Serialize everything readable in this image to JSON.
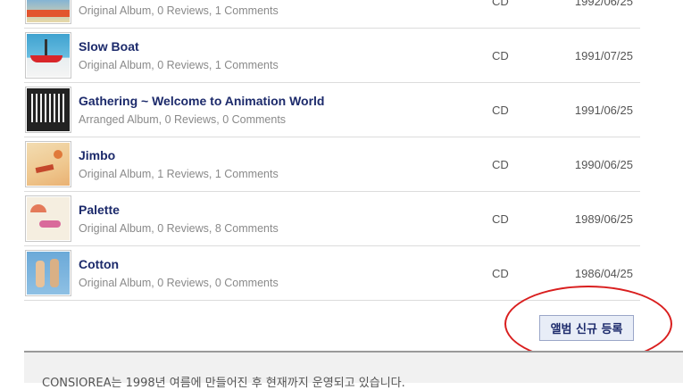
{
  "albums": [
    {
      "title": "",
      "meta": "Original Album, 0 Reviews, 1 Comments",
      "format": "CD",
      "date": "1992/06/25",
      "cover_icon": "album-cover"
    },
    {
      "title": "Slow Boat",
      "meta": "Original Album, 0 Reviews, 1 Comments",
      "format": "CD",
      "date": "1991/07/25",
      "cover_icon": "album-cover"
    },
    {
      "title": "Gathering ~ Welcome to Animation World",
      "meta": "Arranged Album, 0 Reviews, 0 Comments",
      "format": "CD",
      "date": "1991/06/25",
      "cover_icon": "album-cover"
    },
    {
      "title": "Jimbo",
      "meta": "Original Album, 1 Reviews, 1 Comments",
      "format": "CD",
      "date": "1990/06/25",
      "cover_icon": "album-cover"
    },
    {
      "title": "Palette",
      "meta": "Original Album, 0 Reviews, 8 Comments",
      "format": "CD",
      "date": "1989/06/25",
      "cover_icon": "album-cover"
    },
    {
      "title": "Cotton",
      "meta": "Original Album, 0 Reviews, 0 Comments",
      "format": "CD",
      "date": "1986/04/25",
      "cover_icon": "album-cover"
    }
  ],
  "actions": {
    "register_label": "앨범 신규 등록"
  },
  "footer": {
    "text": "CONSIOREA는 1998년 여름에 만들어진 후 현재까지 운영되고 있습니다."
  },
  "colors": {
    "title": "#1c2a6b",
    "meta": "#8a8a8a",
    "highlight": "#d91e1e",
    "footer_bg": "#f1f1f1"
  }
}
